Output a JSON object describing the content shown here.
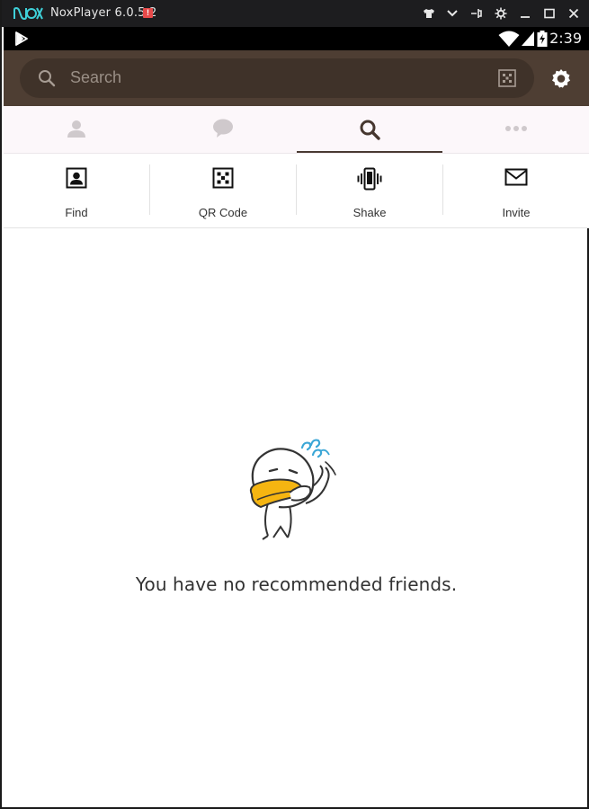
{
  "window": {
    "title": "NoxPlayer 6.0.5.2",
    "alert_badge": "!",
    "logo_text": "nox",
    "controls": [
      "shirt-icon",
      "chevron-down-icon",
      "pin-icon",
      "gear-icon",
      "minimize-icon",
      "maximize-icon",
      "close-icon"
    ]
  },
  "statusbar": {
    "time": "2:39",
    "icons": [
      "play-store-icon",
      "wifi-icon",
      "sim-icon",
      "signal-icon",
      "battery-icon"
    ]
  },
  "header": {
    "search_placeholder": "Search",
    "icons": [
      "search-icon",
      "qr-scan-icon",
      "settings-icon"
    ],
    "background": "#4e3e33"
  },
  "tabs": [
    {
      "icon": "person-icon",
      "active": false
    },
    {
      "icon": "chat-icon",
      "active": false
    },
    {
      "icon": "search-icon",
      "active": true
    },
    {
      "icon": "more-icon",
      "active": false
    }
  ],
  "actions": [
    {
      "label": "Find",
      "icon": "contact-card-icon"
    },
    {
      "label": "QR Code",
      "icon": "qr-code-icon"
    },
    {
      "label": "Shake",
      "icon": "phone-vibrate-icon"
    },
    {
      "label": "Invite",
      "icon": "envelope-icon"
    }
  ],
  "empty_state": {
    "message": "You have no recommended friends.",
    "illustration": "confused-duck-character"
  }
}
